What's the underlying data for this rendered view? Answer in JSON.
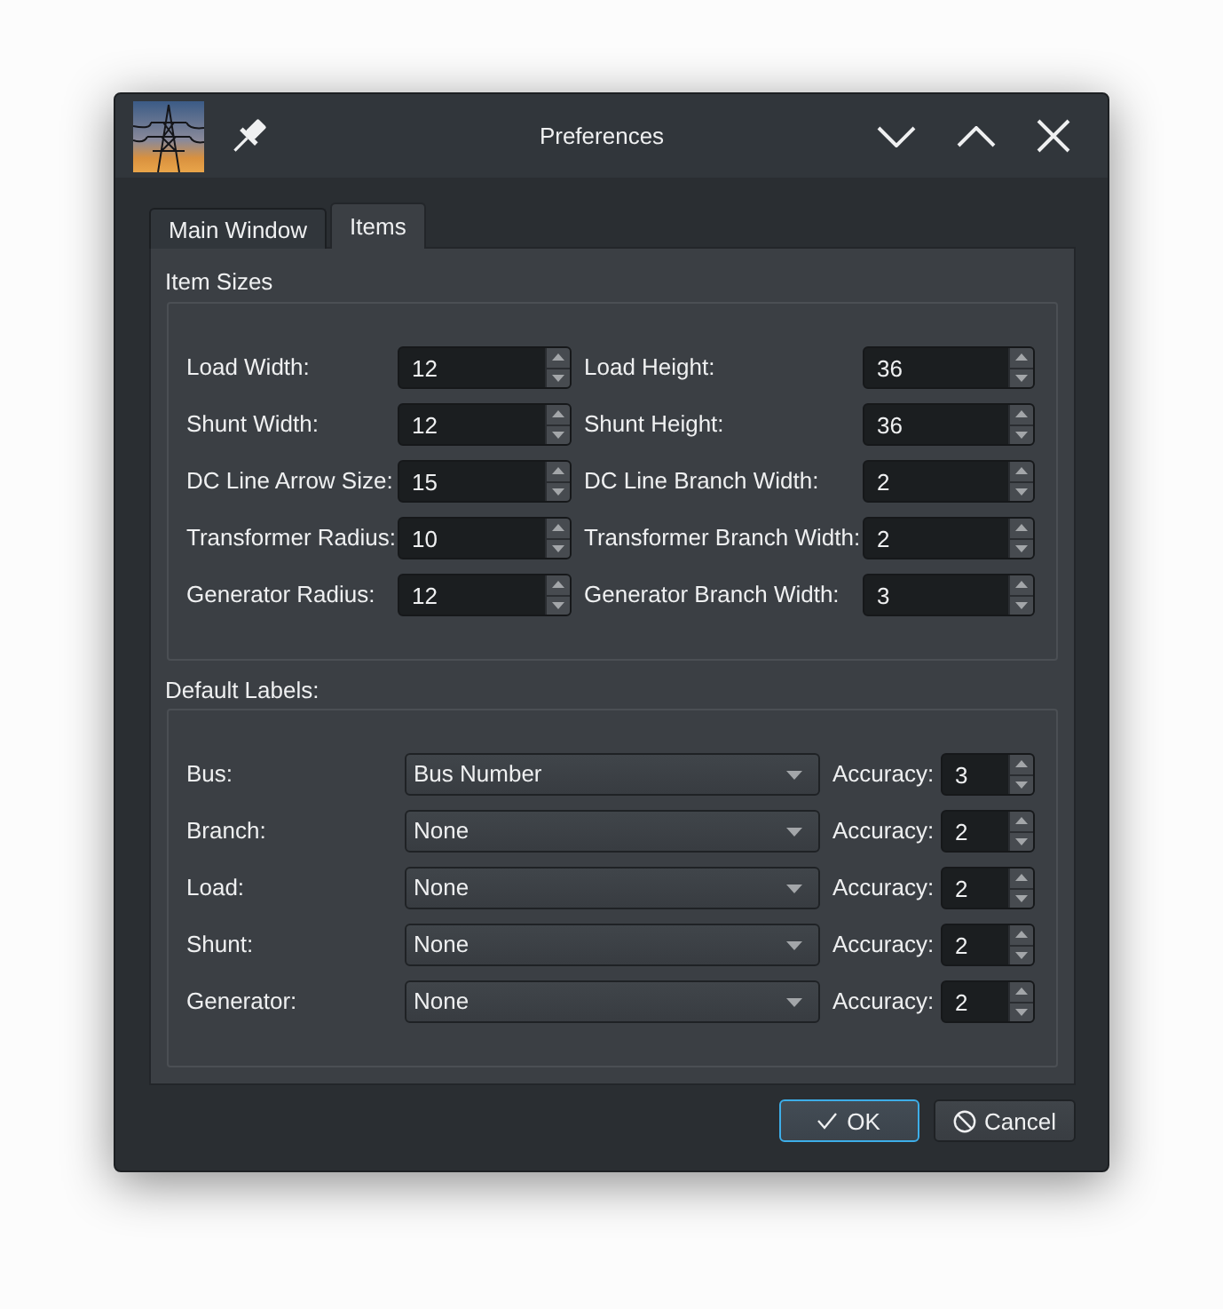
{
  "window": {
    "title": "Preferences"
  },
  "tabs": [
    {
      "label": "Main Window",
      "selected": false
    },
    {
      "label": "Items",
      "selected": true
    }
  ],
  "item_sizes": {
    "title": "Item Sizes",
    "rows": [
      [
        {
          "label": "Load Width:",
          "value": "12"
        },
        {
          "label": "Load Height:",
          "value": "36"
        }
      ],
      [
        {
          "label": "Shunt Width:",
          "value": "12"
        },
        {
          "label": "Shunt Height:",
          "value": "36"
        }
      ],
      [
        {
          "label": "DC Line Arrow Size:",
          "value": "15"
        },
        {
          "label": "DC Line Branch Width:",
          "value": "2"
        }
      ],
      [
        {
          "label": "Transformer Radius:",
          "value": "10"
        },
        {
          "label": "Transformer Branch Width:",
          "value": "2"
        }
      ],
      [
        {
          "label": "Generator Radius:",
          "value": "12"
        },
        {
          "label": "Generator Branch Width:",
          "value": "3"
        }
      ]
    ]
  },
  "default_labels": {
    "title": "Default Labels:",
    "rows": [
      {
        "label": "Bus:",
        "selection": "Bus Number",
        "accuracy_label": "Accuracy:",
        "accuracy": "3"
      },
      {
        "label": "Branch:",
        "selection": "None",
        "accuracy_label": "Accuracy:",
        "accuracy": "2"
      },
      {
        "label": "Load:",
        "selection": "None",
        "accuracy_label": "Accuracy:",
        "accuracy": "2"
      },
      {
        "label": "Shunt:",
        "selection": "None",
        "accuracy_label": "Accuracy:",
        "accuracy": "2"
      },
      {
        "label": "Generator:",
        "selection": "None",
        "accuracy_label": "Accuracy:",
        "accuracy": "2"
      }
    ]
  },
  "buttons": [
    {
      "kind": "ok",
      "label": "OK",
      "default": true
    },
    {
      "kind": "cancel",
      "label": "Cancel",
      "default": false
    }
  ]
}
